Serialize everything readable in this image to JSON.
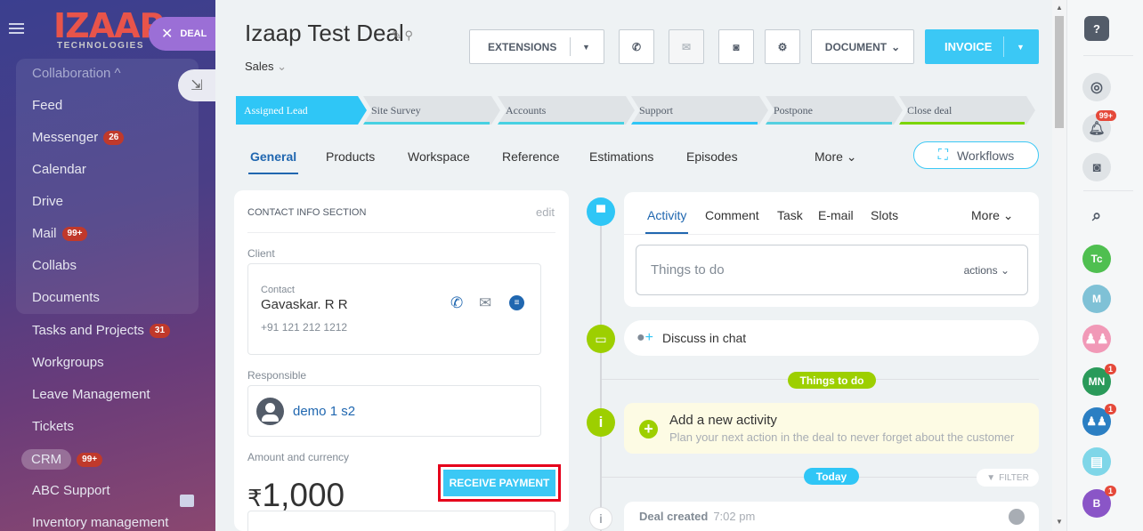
{
  "sidebar": {
    "logo_big": "IZAAP",
    "logo_small": "TECHNOLOGIES",
    "deal_pill": "DEAL",
    "items": [
      {
        "label": "Collaboration ^"
      },
      {
        "label": "Feed"
      },
      {
        "label": "Messenger",
        "badge": "26"
      },
      {
        "label": "Calendar"
      },
      {
        "label": "Drive"
      },
      {
        "label": "Mail",
        "badge": "99+"
      },
      {
        "label": "Collabs"
      },
      {
        "label": "Documents"
      },
      {
        "label": "Tasks and Projects",
        "badge": "31"
      },
      {
        "label": "Workgroups"
      },
      {
        "label": "Leave Management"
      },
      {
        "label": "Tickets"
      },
      {
        "label": "CRM",
        "badge": "99+"
      },
      {
        "label": "ABC Support"
      },
      {
        "label": "Inventory management"
      }
    ]
  },
  "header": {
    "title": "Izaap Test Deal",
    "subtitle": "Sales",
    "extensions": "EXTENSIONS",
    "document": "DOCUMENT",
    "invoice": "INVOICE"
  },
  "stages": [
    {
      "label": "Assigned Lead",
      "color": "#2fc6f6"
    },
    {
      "label": "Site Survey",
      "color": "#47d1e2"
    },
    {
      "label": "Accounts",
      "color": "#47d1e2"
    },
    {
      "label": "Support",
      "color": "#2fc6f6"
    },
    {
      "label": "Postpone",
      "color": "#55d0e0"
    },
    {
      "label": "Close deal",
      "color": "#7bd500"
    }
  ],
  "tabs": [
    "General",
    "Products",
    "Workspace",
    "Reference",
    "Estimations",
    "Episodes",
    "More"
  ],
  "workflows_label": "Workflows",
  "contact_section": {
    "title": "CONTACT INFO SECTION",
    "edit": "edit",
    "client_label": "Client",
    "contact_label": "Contact",
    "contact_name": "Gavaskar. R R",
    "contact_phone": "+91 121 212 1212",
    "responsible_label": "Responsible",
    "responsible_name": "demo 1 s2",
    "amount_label": "Amount and currency",
    "currency_symbol": "₹",
    "amount": "1,000",
    "receive_payment": "RECEIVE PAYMENT"
  },
  "activity": {
    "tabs": [
      "Activity",
      "Comment",
      "Task",
      "E-mail",
      "Slots",
      "More"
    ],
    "todo_placeholder": "Things to do",
    "actions": "actions",
    "discuss": "Discuss in chat",
    "things_to_do_pill": "Things to do",
    "add_title": "Add a new activity",
    "add_desc": "Plan your next action in the deal to never forget about the customer",
    "today": "Today",
    "filter": "FILTER",
    "deal_created": "Deal created",
    "deal_created_time": "7:02 pm"
  },
  "right_panel": {
    "help": "?",
    "notif_badge": "99+",
    "avatars": [
      {
        "initials": "Tc",
        "color": "#4fbf50"
      },
      {
        "initials": "M",
        "color": "#7fc1d6"
      },
      {
        "initials": "",
        "color": "#f199b7"
      },
      {
        "initials": "MN",
        "color": "#2a9a5a",
        "badge": "1"
      },
      {
        "initials": "",
        "color": "#2b7fc3",
        "badge": "1"
      },
      {
        "initials": "",
        "color": "#7fd6e8"
      },
      {
        "initials": "B",
        "color": "#8a55c7",
        "badge": "1"
      }
    ]
  }
}
